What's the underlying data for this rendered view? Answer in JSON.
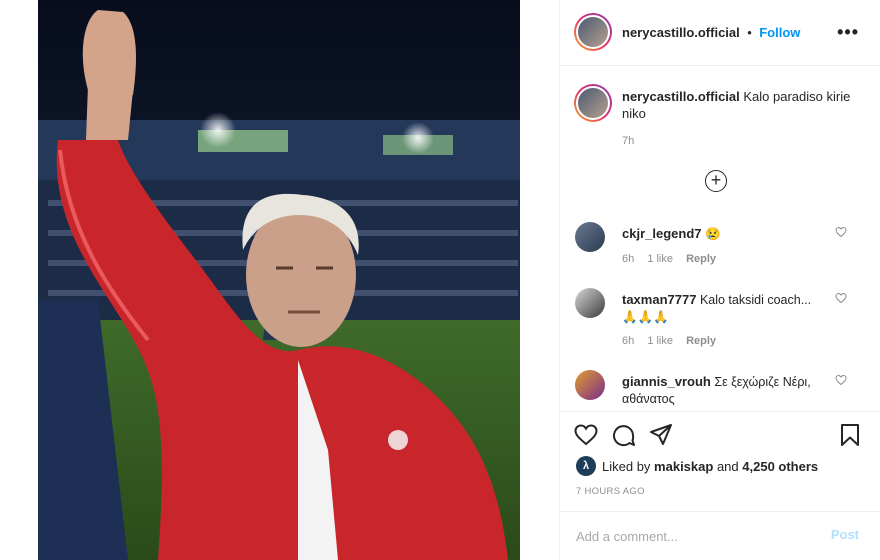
{
  "post": {
    "image_alt": "Coach raising fist in red tracksuit at stadium"
  },
  "header": {
    "username": "nerycastillo.official",
    "separator": "•",
    "follow_label": "Follow",
    "more_label": "•••"
  },
  "caption": {
    "username": "nerycastillo.official",
    "text": "Kalo paradiso kirie niko",
    "time": "7h"
  },
  "load_more_label": "+",
  "comments": [
    {
      "username": "ckjr_legend7",
      "text": "😢",
      "time": "6h",
      "likes": "1 like",
      "reply": "Reply"
    },
    {
      "username": "taxman7777",
      "text": "Kalo taksidi coach... 🙏🙏🙏",
      "time": "6h",
      "likes": "1 like",
      "reply": "Reply"
    },
    {
      "username": "giannis_vrouh",
      "text": "Σε ξεχώριζε Νέρι, αθάνατος",
      "time": "",
      "likes": "",
      "reply": ""
    }
  ],
  "likes": {
    "prefix": "Liked by",
    "user": "makiskap",
    "middle": "and",
    "count": "4,250 others"
  },
  "post_time": "7 HOURS AGO",
  "add_comment": {
    "placeholder": "Add a comment...",
    "post_label": "Post"
  },
  "colors": {
    "accent": "#0095f6",
    "post_disabled": "#b2dffc",
    "jacket_red": "#c8262b"
  }
}
